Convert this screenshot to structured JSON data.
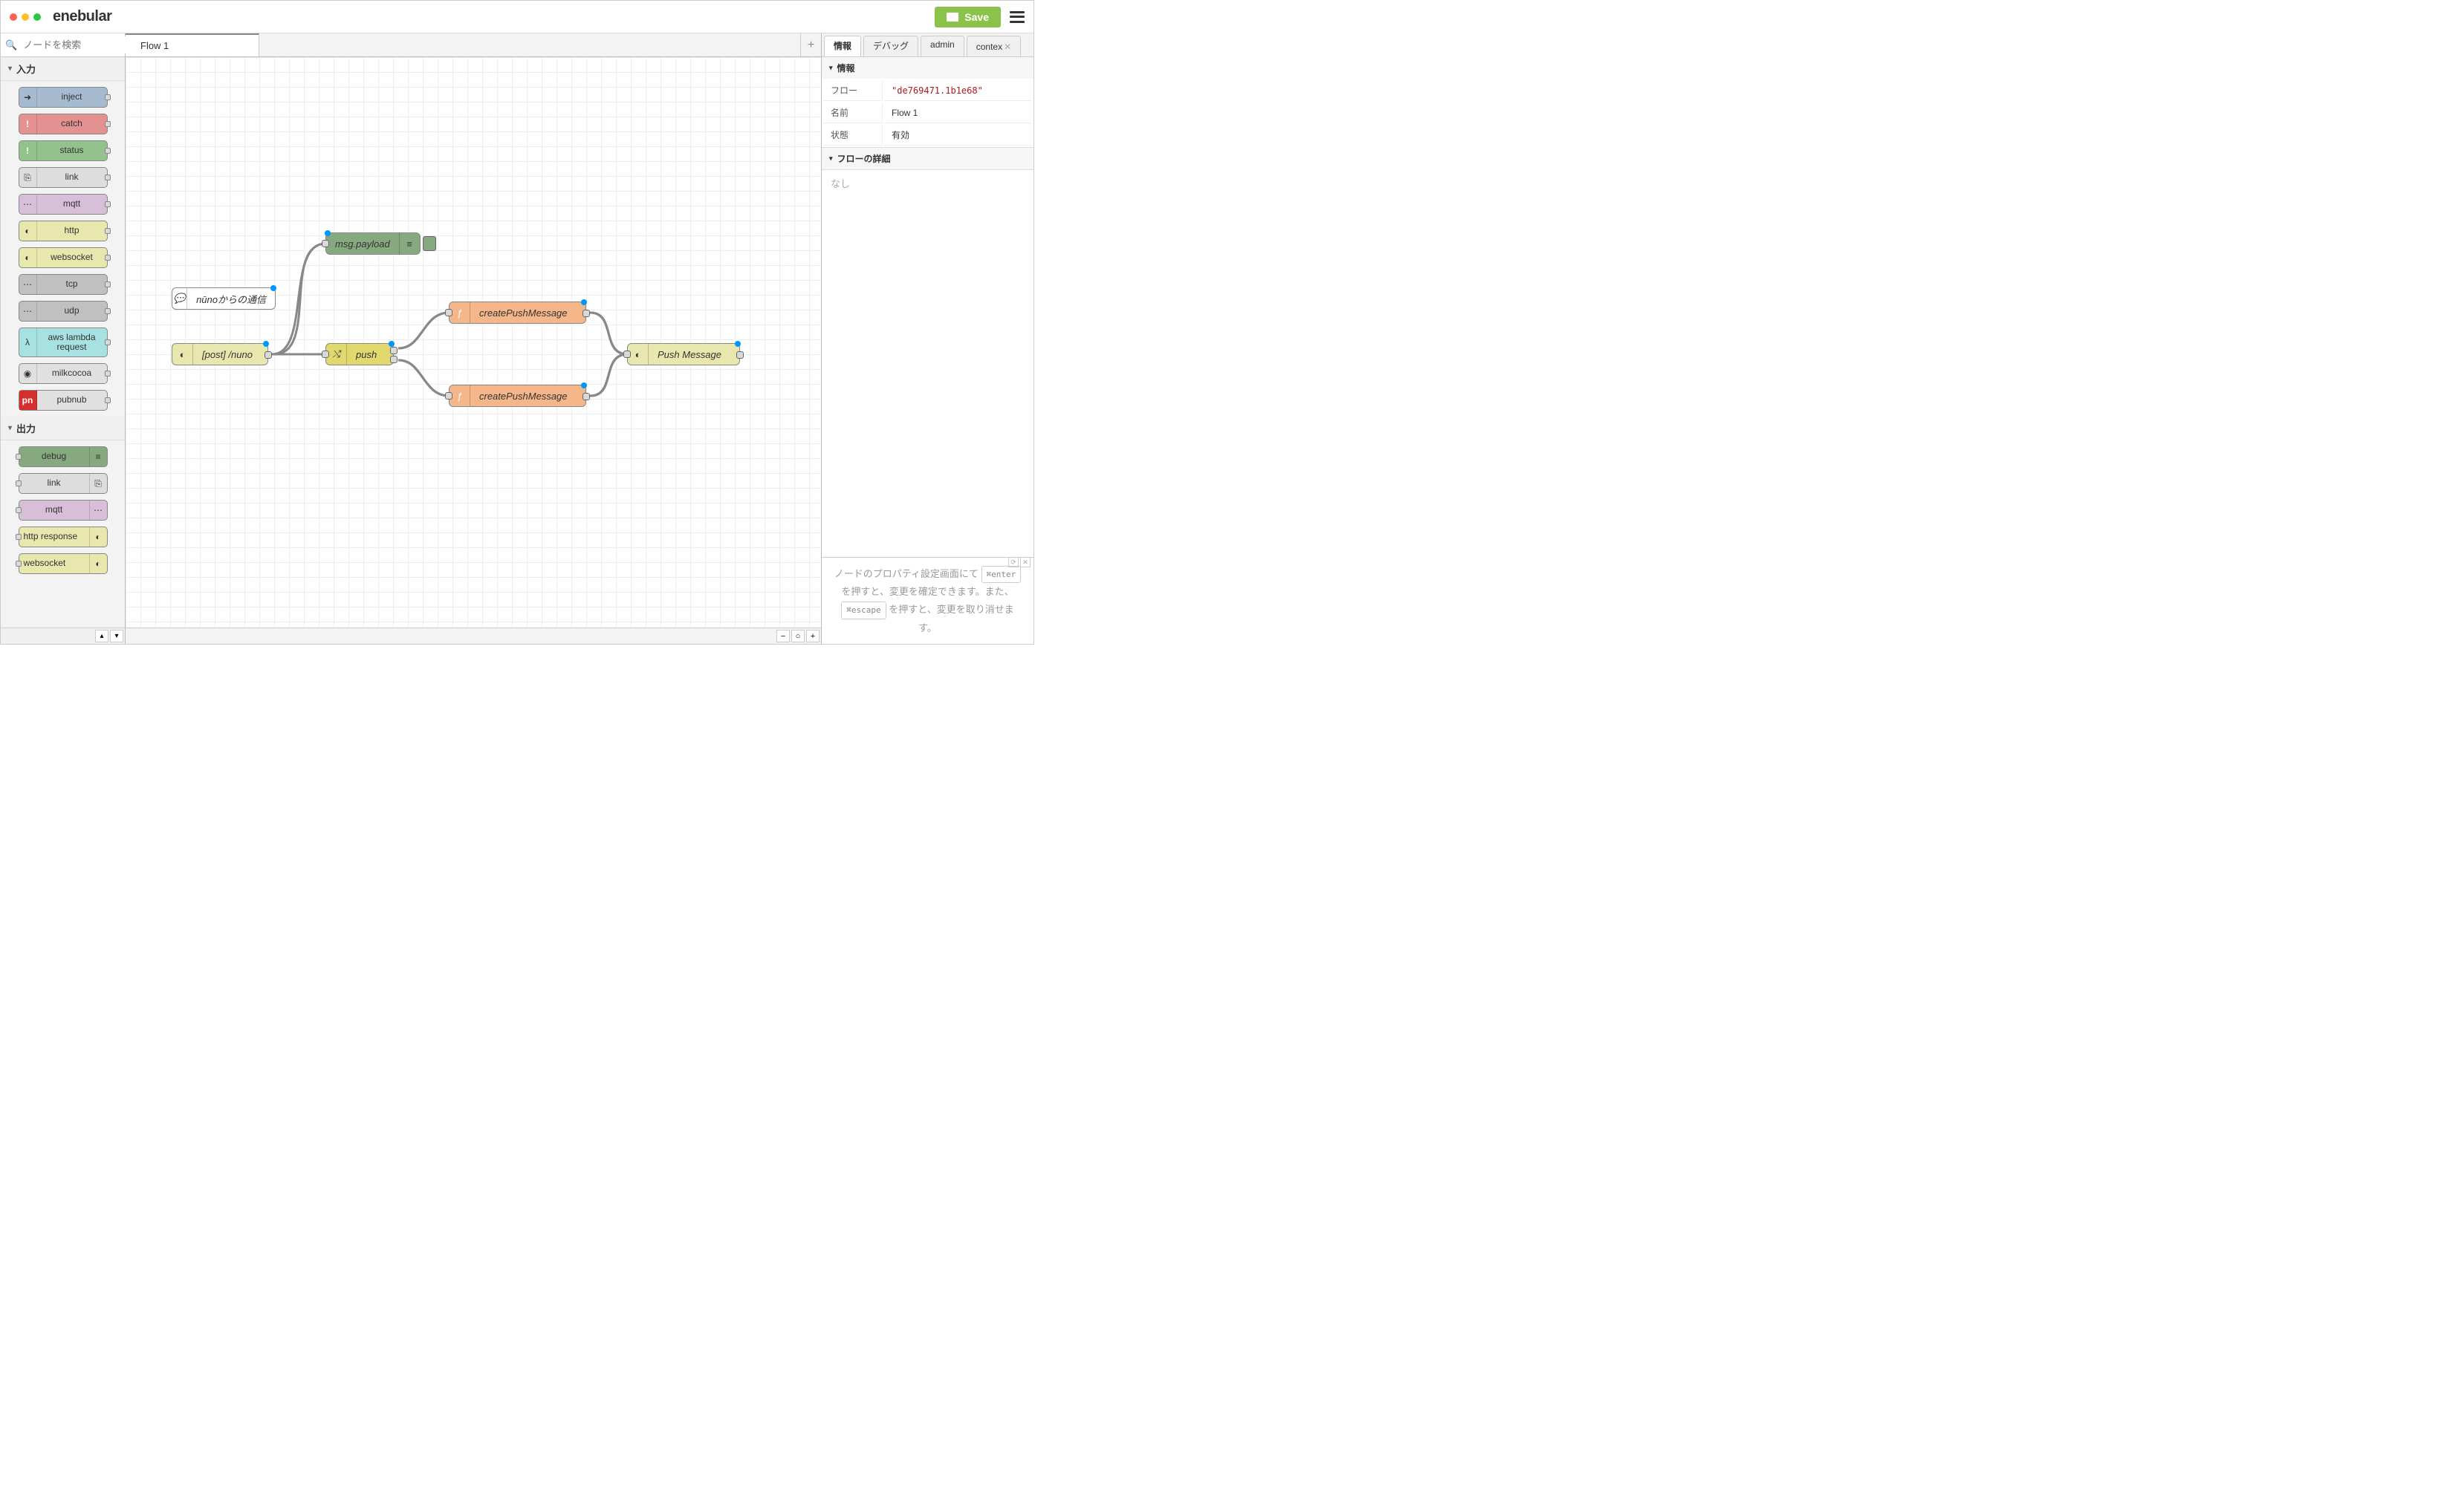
{
  "brand": "enebular",
  "save_label": "Save",
  "palette_search_placeholder": "ノードを検索",
  "palette": {
    "input_header": "入力",
    "output_header": "出力",
    "input_nodes": {
      "inject": "inject",
      "catch": "catch",
      "status": "status",
      "link": "link",
      "mqtt": "mqtt",
      "http": "http",
      "websocket": "websocket",
      "tcp": "tcp",
      "udp": "udp",
      "aws": "aws lambda request",
      "milkcocoa": "milkcocoa",
      "pubnub": "pubnub"
    },
    "output_nodes": {
      "debug": "debug",
      "link": "link",
      "mqtt": "mqtt",
      "httpres": "http response",
      "websocket": "websocket"
    }
  },
  "tabs": {
    "flow1": "Flow 1"
  },
  "canvas": {
    "comment": "nūnoからの通信",
    "httpin": "[post] /nuno",
    "debug": "msg.payload",
    "switch": "push",
    "func1": "createPushMessage",
    "func2": "createPushMessage",
    "httpreq": "Push Message"
  },
  "sidebar": {
    "tabs": {
      "info": "情報",
      "debug": "デバッグ",
      "admin": "admin",
      "context": "contex"
    },
    "info_header": "情報",
    "flow_detail_header": "フローの詳細",
    "rows": {
      "flow_label": "フロー",
      "flow_value": "\"de769471.1b1e68\"",
      "name_label": "名前",
      "name_value": "Flow 1",
      "state_label": "状態",
      "state_value": "有効"
    },
    "none": "なし",
    "tips": {
      "t1": "ノードのプロパティ設定画面にて",
      "k1": "⌘enter",
      "t2": "を押すと、変更を確定できます。また、",
      "k2": "⌘escape",
      "t3": "を押すと、変更を取り消せます。"
    }
  }
}
